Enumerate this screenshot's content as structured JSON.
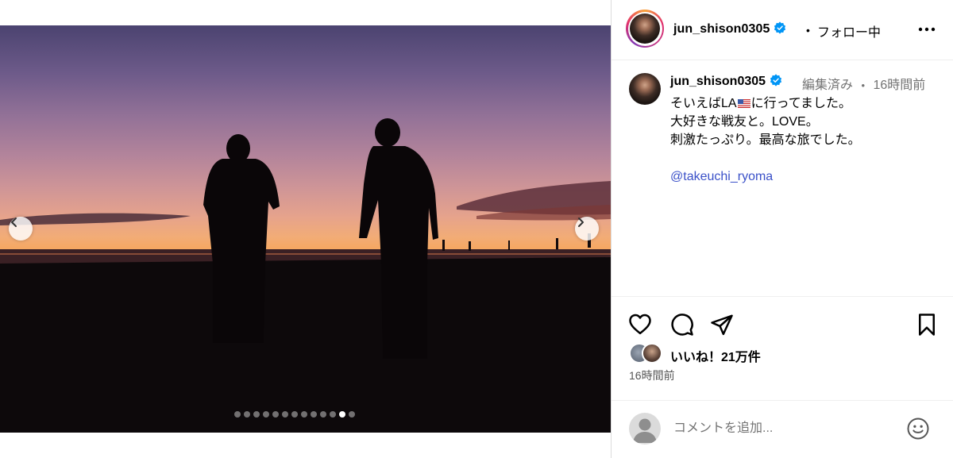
{
  "post": {
    "username": "jun_shison0305",
    "follow_status": "フォロー中",
    "separator": "•"
  },
  "media": {
    "slide_count": 13,
    "active_slide": 12,
    "prev_icon": "chevron-left-icon",
    "next_icon": "chevron-right-icon"
  },
  "caption": {
    "username": "jun_shison0305",
    "edited": "編集済み",
    "separator": "•",
    "time_ago": "16時間前",
    "line1_before": "そいえばLA",
    "line1_flag": "us-flag-emoji",
    "line1_after": "に行ってました。",
    "line2": "大好きな戦友と。LOVE。",
    "line3": "刺激たっぷり。最高な旅でした。",
    "mention": "@takeuchi_ryoma"
  },
  "actions": {
    "icons": [
      "heart-icon",
      "comment-icon",
      "share-icon",
      "bookmark-icon"
    ]
  },
  "likes": {
    "label": "いいね！21万件"
  },
  "timestamp": "16時間前",
  "comment": {
    "placeholder": "コメントを追加..."
  },
  "colors": {
    "accent_blue": "#0095f6",
    "verified": "#0095f6",
    "mention": "#3a50c8",
    "muted": "#737373"
  }
}
